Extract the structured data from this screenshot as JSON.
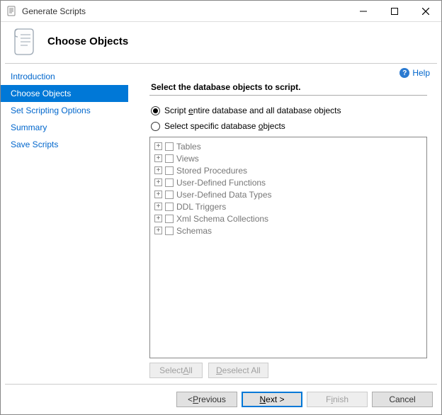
{
  "window": {
    "title": "Generate Scripts"
  },
  "header": {
    "title": "Choose Objects"
  },
  "help": {
    "label": "Help"
  },
  "nav": {
    "items": [
      {
        "label": "Introduction"
      },
      {
        "label": "Choose Objects"
      },
      {
        "label": "Set Scripting Options"
      },
      {
        "label": "Summary"
      },
      {
        "label": "Save Scripts"
      }
    ],
    "selected_index": 1
  },
  "main": {
    "section_title": "Select the database objects to script.",
    "radio": {
      "entire": {
        "label_pre": "Script ",
        "label_key": "e",
        "label_post": "ntire database and all database objects",
        "checked": true
      },
      "specific": {
        "label_pre": "Select specific database ",
        "label_key": "o",
        "label_post": "bjects",
        "checked": false
      }
    },
    "tree": [
      {
        "label": "Tables"
      },
      {
        "label": "Views"
      },
      {
        "label": "Stored Procedures"
      },
      {
        "label": "User-Defined Functions"
      },
      {
        "label": "User-Defined Data Types"
      },
      {
        "label": "DDL Triggers"
      },
      {
        "label": "Xml Schema Collections"
      },
      {
        "label": "Schemas"
      }
    ],
    "select_all": {
      "pre": "Select ",
      "key": "A",
      "post": "ll"
    },
    "deselect_all": {
      "pre": "",
      "key": "D",
      "post": "eselect All"
    }
  },
  "footer": {
    "previous": {
      "pre": "< ",
      "key": "P",
      "post": "revious"
    },
    "next": {
      "pre": "",
      "key": "N",
      "post": "ext >"
    },
    "finish": {
      "pre": "F",
      "key": "i",
      "post": "nish"
    },
    "cancel": {
      "label": "Cancel"
    }
  },
  "colors": {
    "accent": "#0078d7",
    "link": "#0066cc"
  }
}
